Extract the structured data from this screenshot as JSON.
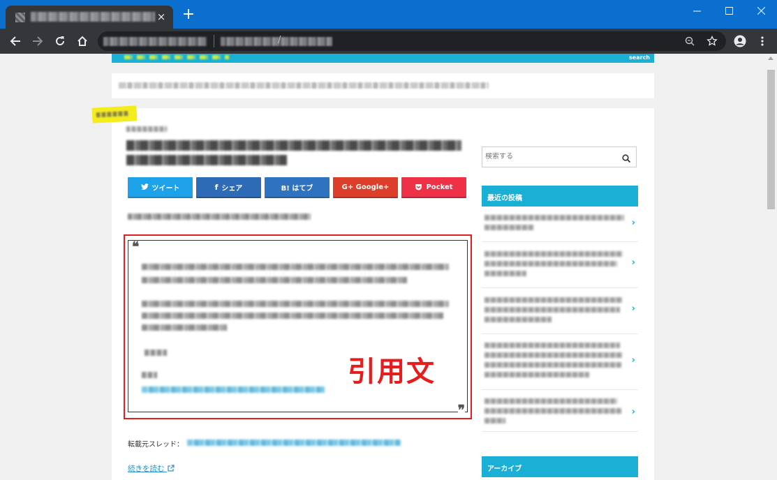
{
  "browser": {
    "new_tab": "+",
    "close_tab": "×",
    "url_slash": "/"
  },
  "site": {
    "header_search": "search"
  },
  "article": {
    "share_buttons": [
      {
        "icon": "twitter-bird-icon",
        "label": "ツイート",
        "color": "#1da1e8"
      },
      {
        "icon": "facebook-f-icon",
        "label": "シェア",
        "color": "#2e6bb7"
      },
      {
        "icon": "hatena-bookmark-icon",
        "label": "B! はてブ",
        "color": "#2f73c0"
      },
      {
        "icon": "google-plus-icon",
        "label": "G+ Google+",
        "color": "#dd3e2a"
      },
      {
        "icon": "pocket-icon",
        "label": "Pocket",
        "color": "#ee3147"
      }
    ],
    "quote_open": "❝",
    "quote_close": "❞",
    "quote_annotation": "引用文",
    "source_label": "転載元スレッド：",
    "read_more": "続きを読む"
  },
  "sidebar": {
    "search_placeholder": "検索する",
    "recent_title": "最近の投稿",
    "archive_title": "アーカイブ",
    "recent_chevron": "›"
  },
  "colors": {
    "brand": "#1ab0d5",
    "annotation_red": "#e41e1e",
    "tab_bar": "#0a6fcf",
    "toolbar": "#35363a",
    "highlight_yellow": "#f5ec1e"
  }
}
